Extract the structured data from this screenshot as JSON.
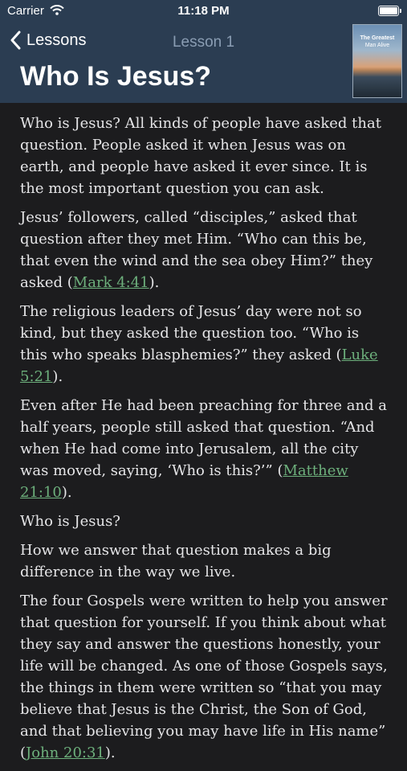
{
  "status": {
    "carrier": "Carrier",
    "time": "11:18 PM"
  },
  "nav": {
    "back_label": "Lessons",
    "title": "Lesson 1"
  },
  "cover": {
    "line1": "The Greatest",
    "line2": "Man Alive"
  },
  "heading": "Who Is Jesus?",
  "paragraphs": [
    {
      "text": "Who is Jesus? All kinds of people have asked that question. People asked it when Jesus was on earth, and people have asked it ever since. It is the most important question you can ask."
    },
    {
      "text": "Jesus’ followers, called “disciples,” asked that question after they met Him. “Who can this be, that even the wind and the sea obey Him?” they asked (",
      "link": "Mark 4:41",
      "after": ")."
    },
    {
      "text": "The religious leaders of Jesus’ day were not so kind, but they asked the question too. “Who is this who speaks blasphemies?” they asked (",
      "link": "Luke 5:21",
      "after": ")."
    },
    {
      "text": "Even after He had been preaching for three and a half years, people still asked that question. “And when He had come into Jerusalem, all the city was moved, saying, ‘Who is this?’” (",
      "link": "Matthew 21:10",
      "after": ")."
    },
    {
      "text": "Who is Jesus?"
    },
    {
      "text": "How we answer that question makes a big difference in the way we live."
    },
    {
      "text": "The four Gospels were written to help you answer that question for yourself. If you think about what they say and answer the questions honestly, your life will be changed. As one of those Gospels says, the things in them were written so “that you may believe that Jesus is the Christ, the Son of God, and that believing you may have life in His name” (",
      "link": "John 20:31",
      "after": ")."
    }
  ]
}
